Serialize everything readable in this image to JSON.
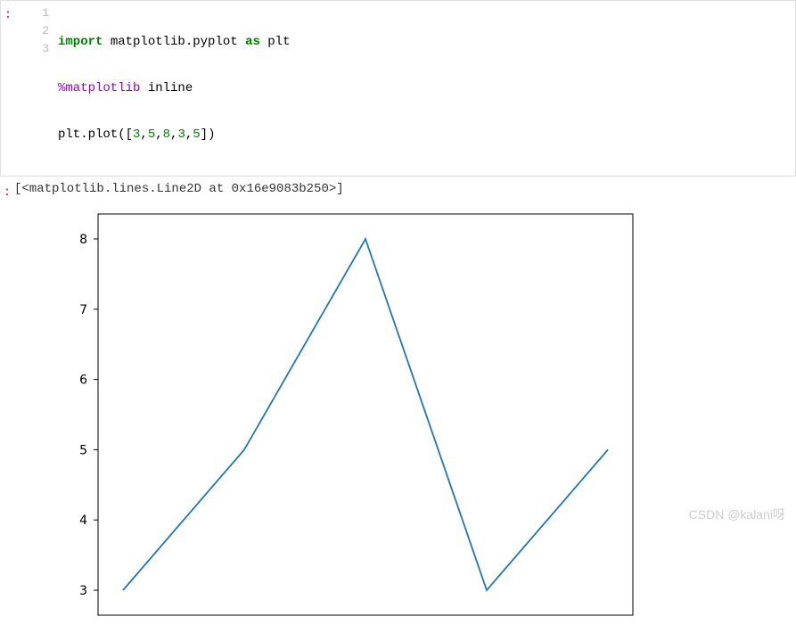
{
  "code": {
    "lines": [
      {
        "n": "1",
        "html": "<span class='kw-import'>import</span> matplotlib.pyplot <span class='kw-as'>as</span> plt"
      },
      {
        "n": "2",
        "html": "<span class='magic'>%matplotlib</span> inline"
      },
      {
        "n": "3",
        "html": "plt.plot([<span class='num'>3</span>,<span class='num'>5</span>,<span class='num'>8</span>,<span class='num'>3</span>,<span class='num'>5</span>])"
      }
    ],
    "prompt_in": ":",
    "prompt_out": ":"
  },
  "output": {
    "text": "[<matplotlib.lines.Line2D at 0x16e9083b250>]"
  },
  "chart_data": {
    "type": "line",
    "x": [
      0,
      1,
      2,
      3,
      4
    ],
    "values": [
      3,
      5,
      8,
      3,
      5
    ],
    "yticks": [
      3,
      4,
      5,
      6,
      7,
      8
    ],
    "ylim": [
      3,
      8
    ],
    "xlim": [
      0,
      4
    ],
    "title": "",
    "xlabel": "",
    "ylabel": ""
  },
  "watermark": "CSDN @kalani呀"
}
